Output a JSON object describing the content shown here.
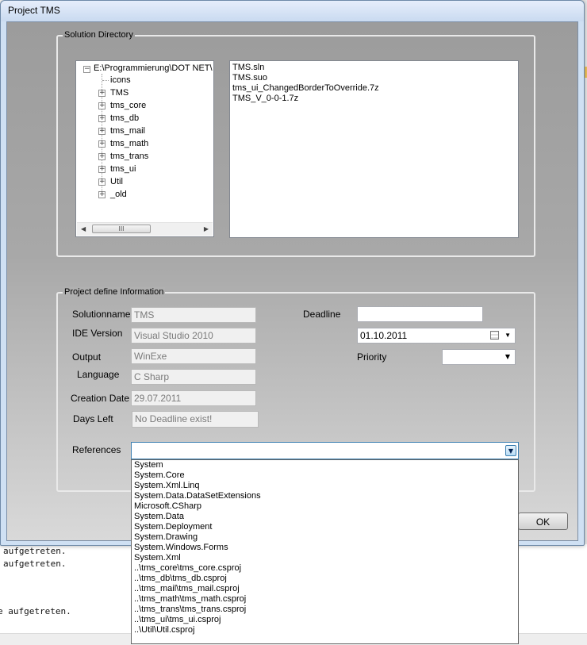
{
  "window": {
    "title": "Project TMS"
  },
  "solution_directory": {
    "group_title": "Solution Directory",
    "tree": {
      "root": "E:\\Programmierung\\DOT NET\\",
      "children": [
        "icons",
        "TMS",
        "tms_core",
        "tms_db",
        "tms_mail",
        "tms_math",
        "tms_trans",
        "tms_ui",
        "Util",
        "_old"
      ]
    },
    "scrollbar_thumb": "III",
    "files": [
      "TMS.sln",
      "TMS.suo",
      "tms_ui_ChangedBorderToOverride.7z",
      "TMS_V_0-0-1.7z"
    ]
  },
  "project_info": {
    "group_title": "Project define Information",
    "solutionname_label": "Solutionname",
    "solutionname_value": "TMS",
    "ide_label": "IDE Version",
    "ide_value": "Visual Studio 2010",
    "output_label": "Output",
    "output_value": "WinExe",
    "language_label": "Language",
    "language_value": "C Sharp",
    "creation_label": "Creation Date",
    "creation_value": "29.07.2011",
    "daysleft_label": "Days Left",
    "daysleft_value": "No Deadline exist!",
    "deadline_label": "Deadline",
    "deadline_value": "",
    "date_value": "01.10.2011",
    "priority_label": "Priority",
    "priority_value": "",
    "references_label": "References",
    "references_value": "",
    "references_options": [
      "System",
      "System.Core",
      "System.Xml.Linq",
      "System.Data.DataSetExtensions",
      "Microsoft.CSharp",
      "System.Data",
      "System.Deployment",
      "System.Drawing",
      "System.Windows.Forms",
      "System.Xml",
      "..\\tms_core\\tms_core.csproj",
      "..\\tms_db\\tms_db.csproj",
      "..\\tms_mail\\tms_mail.csproj",
      "..\\tms_math\\tms_math.csproj",
      "..\\tms_trans\\tms_trans.csproj",
      "..\\tms_ui\\tms_ui.csproj",
      "..\\Util\\Util.csproj"
    ]
  },
  "buttons": {
    "ok": "OK"
  },
  "background_console": [
    "aufgetreten.",
    "aufgetreten.",
    "e aufgetreten."
  ],
  "icons": {
    "expander": "⊞",
    "collapse": "⊟",
    "dropdown": "▼",
    "calendar": "calendar-icon"
  }
}
